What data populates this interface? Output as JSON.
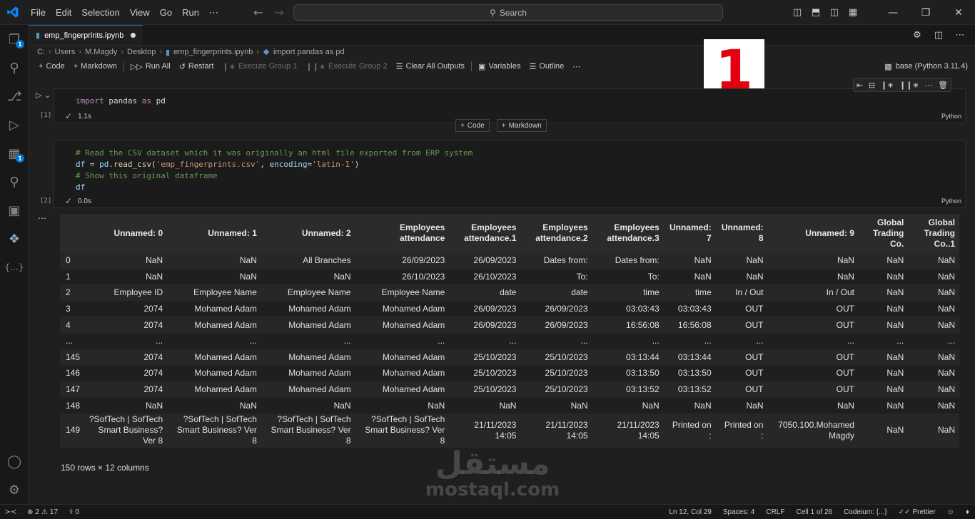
{
  "menu": [
    "File",
    "Edit",
    "Selection",
    "View",
    "Go",
    "Run",
    "⋯"
  ],
  "search": {
    "label": "Search"
  },
  "activity": {
    "explorer_badge": "1",
    "extensions_badge": "1"
  },
  "tab": {
    "filename": "emp_fingerprints.ipynb"
  },
  "breadcrumb": [
    "C:",
    "Users",
    "M.Magdy",
    "Desktop",
    "emp_fingerprints.ipynb",
    "import pandas as pd"
  ],
  "toolbar": {
    "code": "Code",
    "markdown": "Markdown",
    "run_all": "Run All",
    "restart": "Restart",
    "execute_group_1": "Execute Group 1",
    "execute_group_2": "Execute Group 2",
    "clear_outputs": "Clear All Outputs",
    "variables": "Variables",
    "outline": "Outline",
    "more": "⋯",
    "kernel": "base (Python 3.11.4)"
  },
  "overlay_number": "1",
  "cell1": {
    "exec_count": "[1]",
    "time": "1.1s",
    "lang": "Python",
    "code": {
      "kw1": "import",
      "mod": "pandas",
      "kw2": "as",
      "alias": "pd"
    }
  },
  "add_cell": {
    "code": "Code",
    "markdown": "Markdown"
  },
  "cell2": {
    "exec_count": "[2]",
    "time": "0.0s",
    "lang": "Python",
    "comment1": "# Read the CSV dataset which it was originally an html file exported from ERP system",
    "line2": {
      "var": "df",
      "eq": " = ",
      "obj": "pd",
      "dot": ".",
      "fn": "read_csv",
      "open": "(",
      "str1": "'emp_fingerprints.csv'",
      "comma": ", ",
      "param": "encoding",
      "eq2": "=",
      "str2": "'latin-1'",
      "close": ")"
    },
    "comment2": "# Show this original dataframe",
    "line4": "df"
  },
  "output": {
    "dots": "⋯",
    "columns": [
      "",
      "Unnamed: 0",
      "Unnamed: 1",
      "Unnamed: 2",
      "Employees attendance",
      "Employees attendance.1",
      "Employees attendance.2",
      "Employees attendance.3",
      "Unnamed: 7",
      "Unnamed: 8",
      "Unnamed: 9",
      "Global Trading Co.",
      "Global Trading Co..1"
    ],
    "rows": [
      [
        "0",
        "NaN",
        "NaN",
        "All Branches",
        "26/09/2023",
        "26/09/2023",
        "Dates from:",
        "Dates from:",
        "NaN",
        "NaN",
        "NaN",
        "NaN",
        "NaN"
      ],
      [
        "1",
        "NaN",
        "NaN",
        "NaN",
        "26/10/2023",
        "26/10/2023",
        "To:",
        "To:",
        "NaN",
        "NaN",
        "NaN",
        "NaN",
        "NaN"
      ],
      [
        "2",
        "Employee ID",
        "Employee Name",
        "Employee Name",
        "Employee Name",
        "date",
        "date",
        "time",
        "time",
        "In / Out",
        "In / Out",
        "NaN",
        "NaN"
      ],
      [
        "3",
        "2074",
        "Mohamed Adam",
        "Mohamed Adam",
        "Mohamed Adam",
        "26/09/2023",
        "26/09/2023",
        "03:03:43",
        "03:03:43",
        "OUT",
        "OUT",
        "NaN",
        "NaN"
      ],
      [
        "4",
        "2074",
        "Mohamed Adam",
        "Mohamed Adam",
        "Mohamed Adam",
        "26/09/2023",
        "26/09/2023",
        "16:56:08",
        "16:56:08",
        "OUT",
        "OUT",
        "NaN",
        "NaN"
      ],
      [
        "...",
        "...",
        "...",
        "...",
        "...",
        "...",
        "...",
        "...",
        "...",
        "...",
        "...",
        "...",
        "..."
      ],
      [
        "145",
        "2074",
        "Mohamed Adam",
        "Mohamed Adam",
        "Mohamed Adam",
        "25/10/2023",
        "25/10/2023",
        "03:13:44",
        "03:13:44",
        "OUT",
        "OUT",
        "NaN",
        "NaN"
      ],
      [
        "146",
        "2074",
        "Mohamed Adam",
        "Mohamed Adam",
        "Mohamed Adam",
        "25/10/2023",
        "25/10/2023",
        "03:13:50",
        "03:13:50",
        "OUT",
        "OUT",
        "NaN",
        "NaN"
      ],
      [
        "147",
        "2074",
        "Mohamed Adam",
        "Mohamed Adam",
        "Mohamed Adam",
        "25/10/2023",
        "25/10/2023",
        "03:13:52",
        "03:13:52",
        "OUT",
        "OUT",
        "NaN",
        "NaN"
      ],
      [
        "148",
        "NaN",
        "NaN",
        "NaN",
        "NaN",
        "NaN",
        "NaN",
        "NaN",
        "NaN",
        "NaN",
        "NaN",
        "NaN",
        "NaN"
      ],
      [
        "149",
        "?SofTech | SofTech Smart Business? Ver 8",
        "?SofTech | SofTech Smart Business? Ver 8",
        "?SofTech | SofTech Smart Business? Ver 8",
        "?SofTech | SofTech Smart Business? Ver 8",
        "21/11/2023 14:05",
        "21/11/2023 14:05",
        "21/11/2023 14:05",
        "Printed on :",
        "Printed on :",
        "7050.100.Mohamed Magdy",
        "NaN",
        "NaN"
      ]
    ],
    "shape": "150 rows × 12 columns"
  },
  "watermark": {
    "arabic": "مستقل",
    "latin": "mostaql.com"
  },
  "status": {
    "errors": "2",
    "warnings": "17",
    "ports": "0",
    "position": "Ln 12, Col 29",
    "spaces": "Spaces: 4",
    "eol": "CRLF",
    "cell": "Cell 1 of 26",
    "codeium": "Codeium: {...}",
    "prettier": "Prettier"
  },
  "colors": {
    "accent": "#0078d4",
    "overlay_red": "#e3000f",
    "success": "#89d185"
  }
}
